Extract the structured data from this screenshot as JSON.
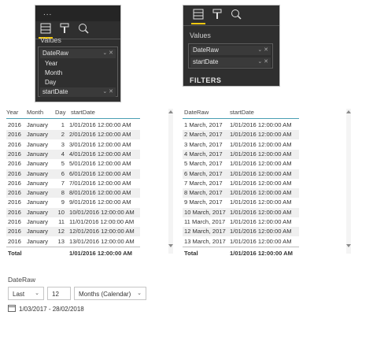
{
  "panel_left": {
    "menu_dots": "...",
    "values_label": "Values",
    "field_dateraw": "DateRaw",
    "hierarchy": [
      "Year",
      "Month",
      "Day"
    ],
    "field_startdate": "startDate"
  },
  "panel_right": {
    "values_label": "Values",
    "field_dateraw": "DateRaw",
    "field_startdate": "startDate",
    "filters_label": "FILTERS"
  },
  "table_left": {
    "headers": [
      "Year",
      "Month",
      "Day",
      "startDate"
    ],
    "rows": [
      [
        "2016",
        "January",
        "1",
        "1/01/2016 12:00:00 AM"
      ],
      [
        "2016",
        "January",
        "2",
        "2/01/2016 12:00:00 AM"
      ],
      [
        "2016",
        "January",
        "3",
        "3/01/2016 12:00:00 AM"
      ],
      [
        "2016",
        "January",
        "4",
        "4/01/2016 12:00:00 AM"
      ],
      [
        "2016",
        "January",
        "5",
        "5/01/2016 12:00:00 AM"
      ],
      [
        "2016",
        "January",
        "6",
        "6/01/2016 12:00:00 AM"
      ],
      [
        "2016",
        "January",
        "7",
        "7/01/2016 12:00:00 AM"
      ],
      [
        "2016",
        "January",
        "8",
        "8/01/2016 12:00:00 AM"
      ],
      [
        "2016",
        "January",
        "9",
        "9/01/2016 12:00:00 AM"
      ],
      [
        "2016",
        "January",
        "10",
        "10/01/2016 12:00:00 AM"
      ],
      [
        "2016",
        "January",
        "11",
        "11/01/2016 12:00:00 AM"
      ],
      [
        "2016",
        "January",
        "12",
        "12/01/2016 12:00:00 AM"
      ],
      [
        "2016",
        "January",
        "13",
        "13/01/2016 12:00:00 AM"
      ]
    ],
    "total_label": "Total",
    "total_value": "1/01/2016 12:00:00 AM"
  },
  "table_right": {
    "headers": [
      "DateRaw",
      "startDate"
    ],
    "rows": [
      [
        "1 March, 2017",
        "1/01/2016 12:00:00 AM"
      ],
      [
        "2 March, 2017",
        "1/01/2016 12:00:00 AM"
      ],
      [
        "3 March, 2017",
        "1/01/2016 12:00:00 AM"
      ],
      [
        "4 March, 2017",
        "1/01/2016 12:00:00 AM"
      ],
      [
        "5 March, 2017",
        "1/01/2016 12:00:00 AM"
      ],
      [
        "6 March, 2017",
        "1/01/2016 12:00:00 AM"
      ],
      [
        "7 March, 2017",
        "1/01/2016 12:00:00 AM"
      ],
      [
        "8 March, 2017",
        "1/01/2016 12:00:00 AM"
      ],
      [
        "9 March, 2017",
        "1/01/2016 12:00:00 AM"
      ],
      [
        "10 March, 2017",
        "1/01/2016 12:00:00 AM"
      ],
      [
        "11 March, 2017",
        "1/01/2016 12:00:00 AM"
      ],
      [
        "12 March, 2017",
        "1/01/2016 12:00:00 AM"
      ],
      [
        "13 March, 2017",
        "1/01/2016 12:00:00 AM"
      ]
    ],
    "total_label": "Total",
    "total_value": "1/01/2016 12:00:00 AM"
  },
  "slicer": {
    "title": "DateRaw",
    "mode": "Last",
    "count": "12",
    "unit": "Months (Calendar)",
    "range": "1/03/2017 - 28/02/2018"
  },
  "colors": {
    "accent_yellow": "#f2c811",
    "header_rule": "#4a9fb3",
    "panel_bg": "#2f2f2f"
  }
}
